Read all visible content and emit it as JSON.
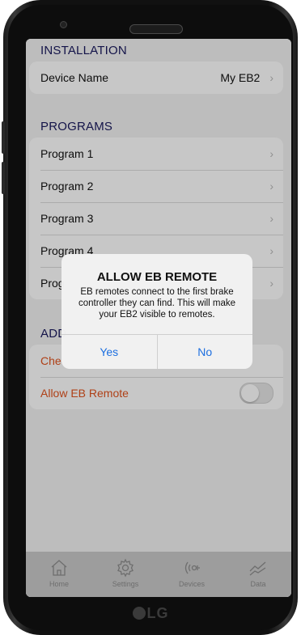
{
  "device": {
    "brand": "LG"
  },
  "installation": {
    "header": "INSTALLATION",
    "device_name_label": "Device Name",
    "device_name_value": "My EB2"
  },
  "programs": {
    "header": "PROGRAMS",
    "items": [
      {
        "label": "Program 1"
      },
      {
        "label": "Program 2"
      },
      {
        "label": "Program 3"
      },
      {
        "label": "Program 4"
      },
      {
        "label": "Prog"
      }
    ]
  },
  "add": {
    "header": "ADD",
    "check_label": "Che",
    "allow_remote_label": "Allow EB Remote",
    "allow_remote_enabled": false
  },
  "dialog": {
    "title": "ALLOW EB REMOTE",
    "message": "EB remotes connect to the first brake controller they can find. This will make your EB2 visible to remotes.",
    "yes_label": "Yes",
    "no_label": "No"
  },
  "tabbar": {
    "tabs": [
      {
        "label": "Home",
        "icon": "home-icon"
      },
      {
        "label": "Settings",
        "icon": "gear-icon"
      },
      {
        "label": "Devices",
        "icon": "wireless-icon"
      },
      {
        "label": "Data",
        "icon": "chart-icon"
      }
    ]
  },
  "colors": {
    "section_header": "#1a1a5e",
    "accent_orange": "#e0531e",
    "dialog_button": "#1d6fe0"
  }
}
